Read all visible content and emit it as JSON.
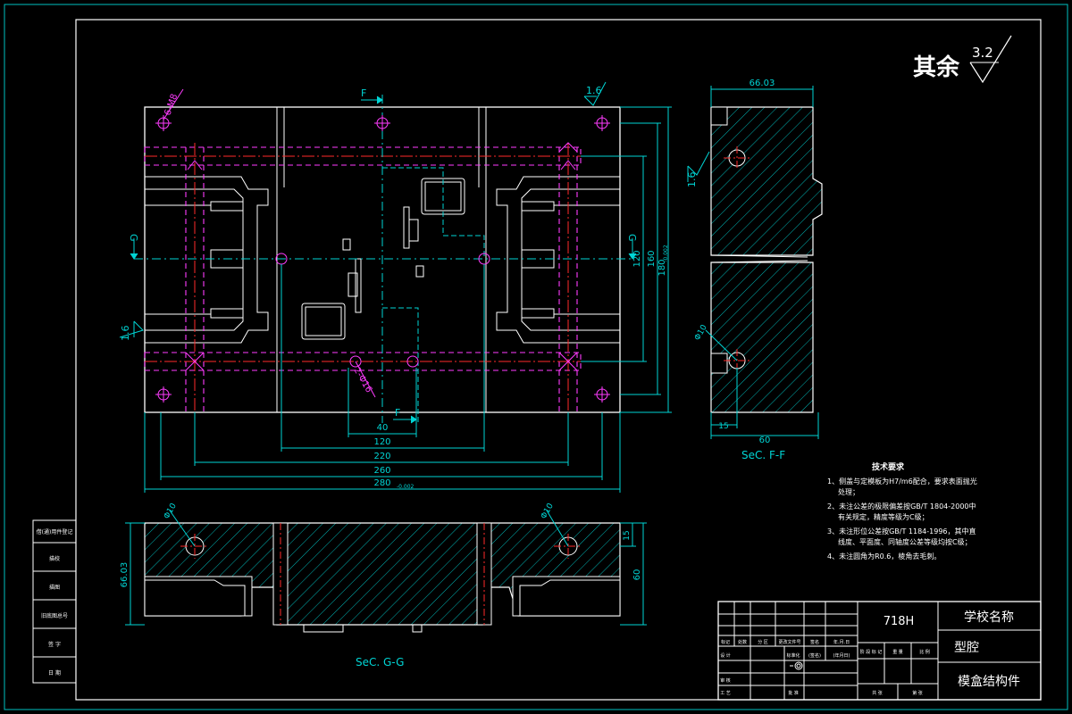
{
  "drawing": {
    "surface_note": {
      "text": "其余",
      "roughness": "3.2"
    },
    "roughness_marks": [
      "1.6",
      "1.6",
      "1.6"
    ],
    "section_labels": {
      "top_marker": "F",
      "side_marker": "G",
      "sec_ff": "SeC. F-F",
      "sec_gg": "SeC. G-G"
    },
    "callouts": {
      "holes_top": "6-M8",
      "holes_mid": "2-Φ16",
      "phi10_a": "Φ10",
      "phi10_b": "Φ10",
      "phi10_c": "Φ10"
    },
    "dims_plan": {
      "d40": "40",
      "d120": "120",
      "d220": "220",
      "d260": "260",
      "d280": "280",
      "d280_tol": "-0.002",
      "v120": "120",
      "v160": "160",
      "v180": "180",
      "v180_tol": "-0.002"
    },
    "dims_ff": {
      "top": "66.03",
      "bottom": "60",
      "small": "15"
    },
    "dims_gg": {
      "left": "66.03",
      "right": "60",
      "small": "15"
    },
    "colors": {
      "line": "#ffffff",
      "dim": "#00d5d5",
      "hidden": "#ff3cff",
      "center": "#ff2a2a",
      "frame": "#00c0c0"
    }
  },
  "tech_req": {
    "title": "技术要求",
    "items": [
      "1、侧盖与定模板为H7/m6配合，要求表面抛光",
      "处理；",
      "2、未注公差的极限偏差按GB/T 1804-2000中",
      "有关规定，精度等级为C级；",
      "3、未注形位公差按GB/T 1184-1996，其中直",
      "线度、平面度、同轴度公差等级均按C级；",
      "4、未注圆角为R0.6，棱角去毛刺。"
    ]
  },
  "side_labels": [
    "借(通)用件登记",
    "旧底图总号",
    "描图",
    "签 字",
    "日 期",
    "描校"
  ],
  "title_block": {
    "material": "718H",
    "school": "学校名称",
    "part": "型腔",
    "assembly": "模盒结构件",
    "header_row": [
      "标记",
      "处数",
      "分 区",
      "更改文件号",
      "签名",
      "年.月.日"
    ],
    "stage_row": [
      "阶 段 标 记",
      "重 量",
      "比 例"
    ],
    "rows": [
      "设 计",
      "标准化",
      "(签名)",
      "(年月日)",
      "审 核",
      "工 艺",
      "批 准"
    ],
    "sheet_row": [
      "共 张",
      "第 张"
    ]
  }
}
